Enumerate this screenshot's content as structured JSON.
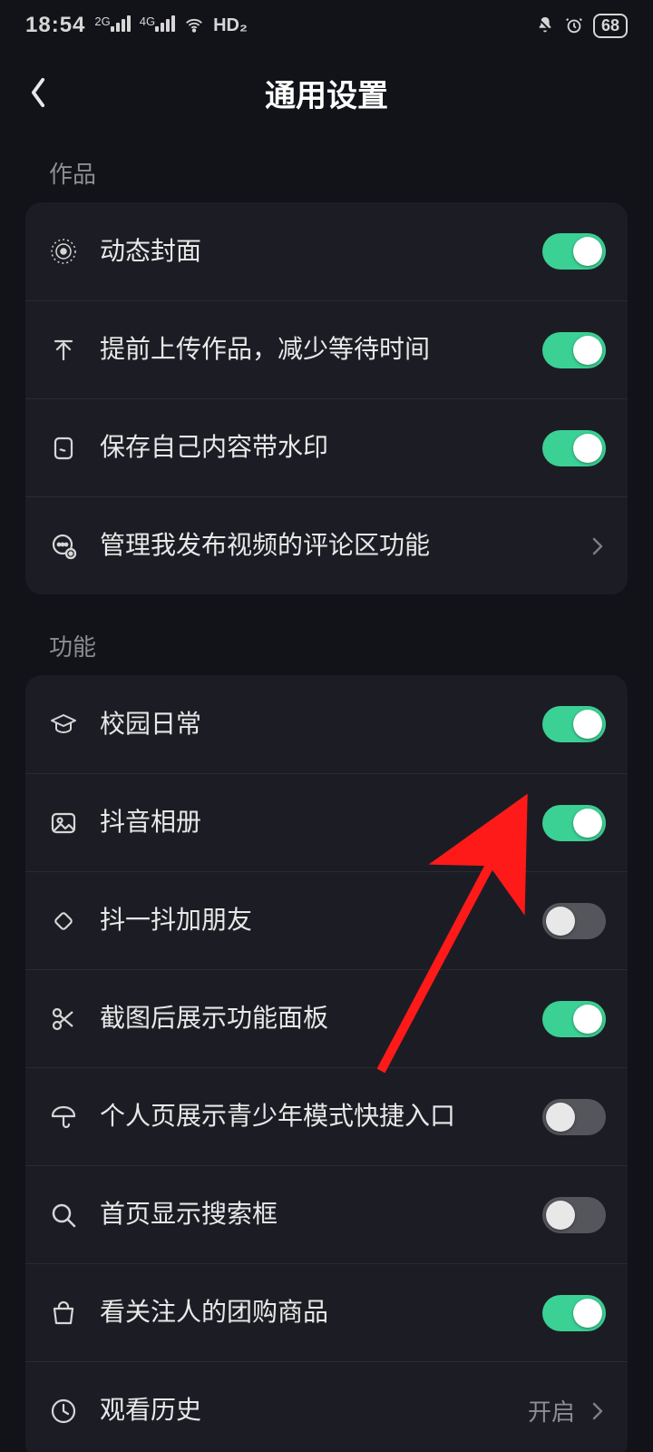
{
  "status": {
    "time": "18:54",
    "net1": "2G",
    "net2": "4G",
    "hd": "HD₂",
    "battery": "68"
  },
  "header": {
    "title": "通用设置"
  },
  "sections": {
    "works": {
      "label": "作品",
      "items": {
        "dynamic_cover": {
          "label": "动态封面",
          "toggle": true
        },
        "pre_upload": {
          "label": "提前上传作品，减少等待时间",
          "toggle": true
        },
        "watermark": {
          "label": "保存自己内容带水印",
          "toggle": true
        },
        "comment_mgmt": {
          "label": "管理我发布视频的评论区功能",
          "nav": true
        }
      }
    },
    "features": {
      "label": "功能",
      "items": {
        "campus": {
          "label": "校园日常",
          "toggle": true
        },
        "album": {
          "label": "抖音相册",
          "toggle": true
        },
        "shake_friends": {
          "label": "抖一抖加朋友",
          "toggle": false
        },
        "screenshot_panel": {
          "label": "截图后展示功能面板",
          "toggle": true
        },
        "teen_shortcut": {
          "label": "个人页展示青少年模式快捷入口",
          "toggle": false
        },
        "home_search": {
          "label": "首页显示搜索框",
          "toggle": false
        },
        "follow_groupbuy": {
          "label": "看关注人的团购商品",
          "toggle": true
        },
        "watch_history": {
          "label": "观看历史",
          "value": "开启",
          "nav": true
        }
      }
    }
  }
}
